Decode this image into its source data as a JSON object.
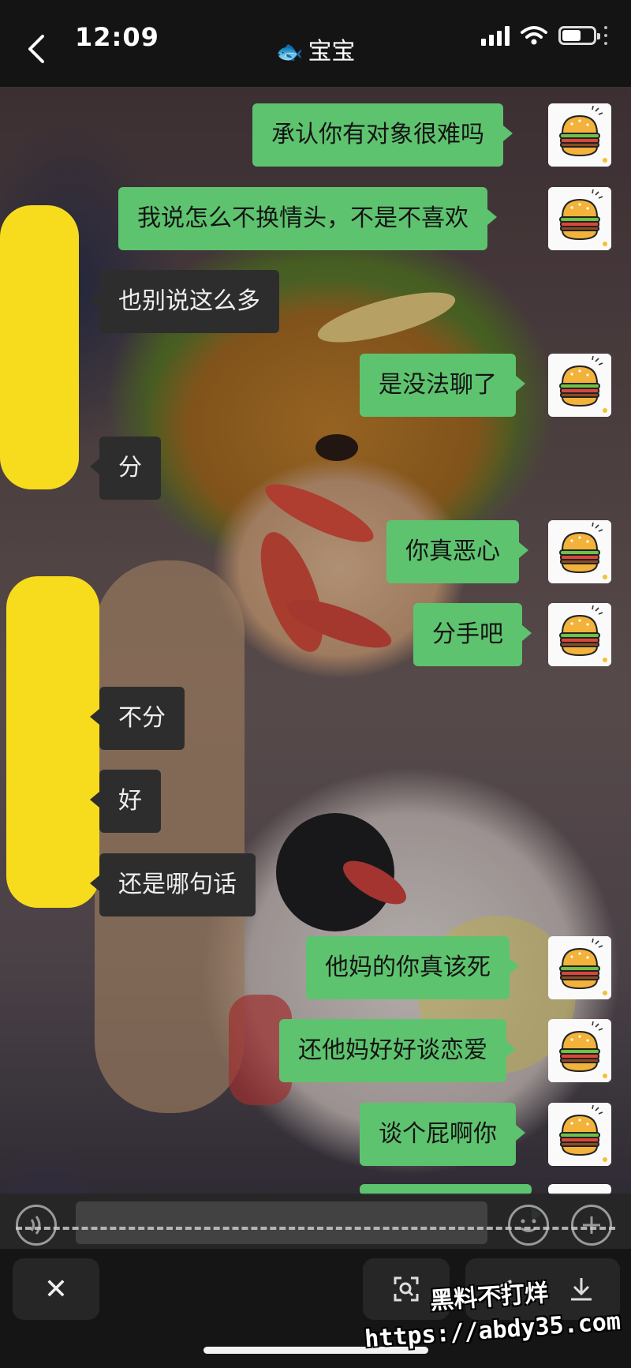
{
  "status_bar": {
    "time": "12:09"
  },
  "header": {
    "title": "宝宝",
    "fish_glyph": "🐟"
  },
  "messages": [
    {
      "direction": "out",
      "text": "承认你有对象很难吗"
    },
    {
      "direction": "out",
      "text": "我说怎么不换情头，不是不喜欢"
    },
    {
      "direction": "in",
      "text": "也别说这么多"
    },
    {
      "direction": "out",
      "text": "是没法聊了"
    },
    {
      "direction": "in",
      "text": "分"
    },
    {
      "direction": "out",
      "text": "你真恶心"
    },
    {
      "direction": "out",
      "text": "分手吧"
    },
    {
      "direction": "in",
      "text": "不分"
    },
    {
      "direction": "in",
      "text": "好"
    },
    {
      "direction": "in",
      "text": "还是哪句话"
    },
    {
      "direction": "out",
      "text": "他妈的你真该死"
    },
    {
      "direction": "out",
      "text": "还他妈好好谈恋爱"
    },
    {
      "direction": "out",
      "text": "谈个屁啊你"
    }
  ],
  "bottom_toolbar": {
    "close_glyph": "✕"
  },
  "watermark": {
    "line1": "黑料不打烊",
    "line2": "https://abdy35.com"
  },
  "colors": {
    "outgoing_bubble": "#5ec36f",
    "incoming_bubble": "#2d2d2d",
    "redaction": "#f7dc1e"
  },
  "icons": [
    "chevron-left-icon",
    "signal-icon",
    "wifi-icon",
    "battery-icon",
    "burger-avatar-icon",
    "voice-icon",
    "emoji-icon",
    "plus-icon",
    "close-icon",
    "scan-icon",
    "share-icon",
    "download-icon"
  ]
}
